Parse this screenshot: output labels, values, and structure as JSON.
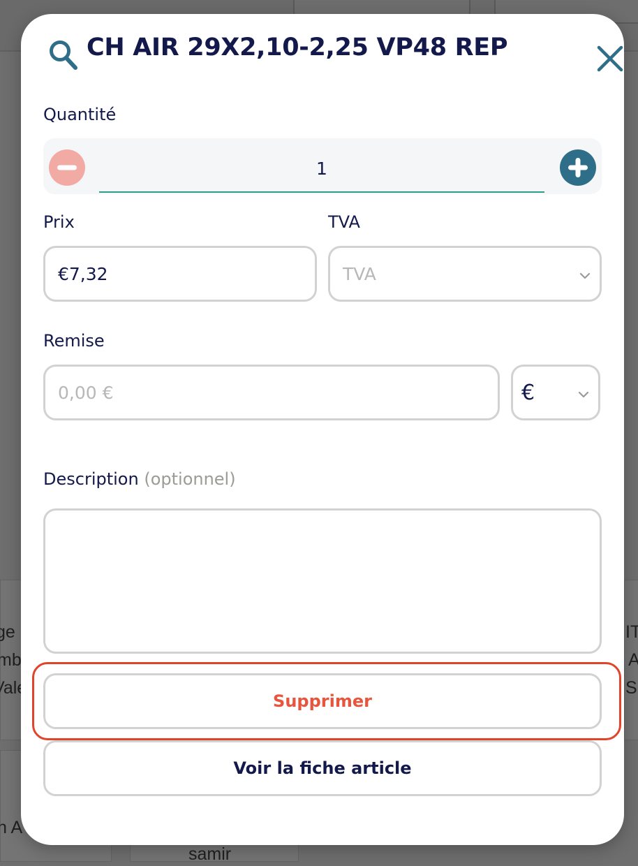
{
  "modal": {
    "title": "CH AIR 29X2,10-2,25 VP48 REP"
  },
  "quantity": {
    "label": "Quantité",
    "value": "1"
  },
  "price": {
    "label": "Prix",
    "value": "€7,32"
  },
  "vat": {
    "label": "TVA",
    "placeholder": "TVA"
  },
  "discount": {
    "label": "Remise",
    "placeholder": "0,00 €",
    "unit": "€"
  },
  "description": {
    "label": "Description",
    "optional": "(optionnel)",
    "value": ""
  },
  "actions": {
    "delete_label": "Supprimer",
    "view_label": "Voir la fiche article"
  },
  "background": {
    "left_fragments": [
      "ge",
      "mb",
      "Vale"
    ],
    "right_fragments": [
      "IT",
      "A",
      "S"
    ],
    "bottom_left": "n A",
    "bottom_name": "samir"
  },
  "colors": {
    "title": "#13194a",
    "accent_teal": "#2e6e88",
    "minus_pink": "#f2aaa5",
    "delete_red": "#e8553d",
    "focus_ring": "#e0452c",
    "underline_teal": "#2f9b8c"
  },
  "icons": {
    "search": "search-icon",
    "close": "close-icon",
    "minus": "minus-circle-icon",
    "plus": "plus-circle-icon",
    "chevron": "chevron-down-icon"
  }
}
